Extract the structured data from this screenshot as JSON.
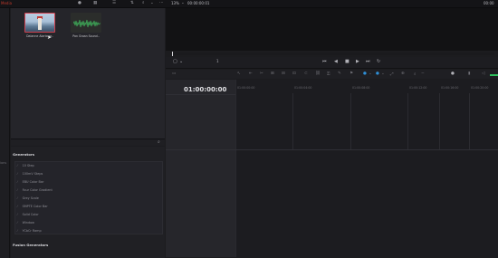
{
  "app": {
    "brand": "Media"
  },
  "topbar": {
    "zoom": "13%",
    "source_timecode": "00:00:00:01",
    "right_timecode": "00:00"
  },
  "left_strip": {
    "labels": [
      "ions"
    ]
  },
  "media_pool": {
    "clips": [
      {
        "name": "Dalanne Alarta.ar.."
      },
      {
        "name": "Pan Groan Sound.."
      }
    ]
  },
  "generators": {
    "title": "Generators",
    "items": [
      "10 Step",
      "100mV Steps",
      "EBU Color Bar",
      "Four Color Gradient",
      "Grey Scale",
      "SMPTE Color Bar",
      "Solid Color",
      "Window",
      "YCbCr Ramp"
    ],
    "fusion_title": "Fusion Generators"
  },
  "viewer": {
    "transport_page": "1"
  },
  "timeline": {
    "timecode": "01:00:00:00",
    "ruler_labels": [
      "01:00:00:00",
      "01:00:04:00",
      "01:00:08:00",
      "01:00:12:00",
      "01:00:16:00",
      "01:00:20:00"
    ]
  },
  "colors": {
    "accent_red": "#d0414f",
    "accent_green": "#2fbf5d",
    "accent_blue": "#2f8fd6"
  }
}
